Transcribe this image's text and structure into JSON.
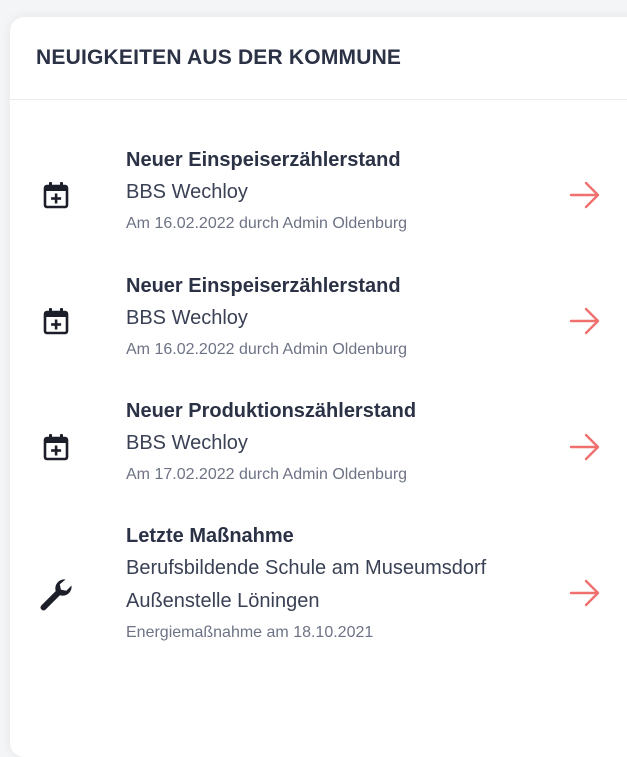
{
  "header": {
    "title": "NEUIGKEITEN AUS DER KOMMUNE"
  },
  "colors": {
    "accent": "#f0706e",
    "text": "#2b3245",
    "muted": "#6d7385"
  },
  "news": [
    {
      "icon": "calendar-plus-icon",
      "title": "Neuer Einspeiserzählerstand",
      "subtitle": "BBS Wechloy",
      "meta": "Am 16.02.2022 durch Admin Oldenburg"
    },
    {
      "icon": "calendar-plus-icon",
      "title": "Neuer Einspeiserzählerstand",
      "subtitle": "BBS Wechloy",
      "meta": "Am 16.02.2022 durch Admin Oldenburg"
    },
    {
      "icon": "calendar-plus-icon",
      "title": "Neuer Produktionszählerstand",
      "subtitle": "BBS Wechloy",
      "meta": "Am 17.02.2022 durch Admin Oldenburg"
    },
    {
      "icon": "wrench-icon",
      "title": "Letzte Maßnahme",
      "subtitle": "Berufsbildende Schule am Museumsdorf Außenstelle Löningen",
      "meta": "Energiemaßnahme am 18.10.2021"
    }
  ]
}
